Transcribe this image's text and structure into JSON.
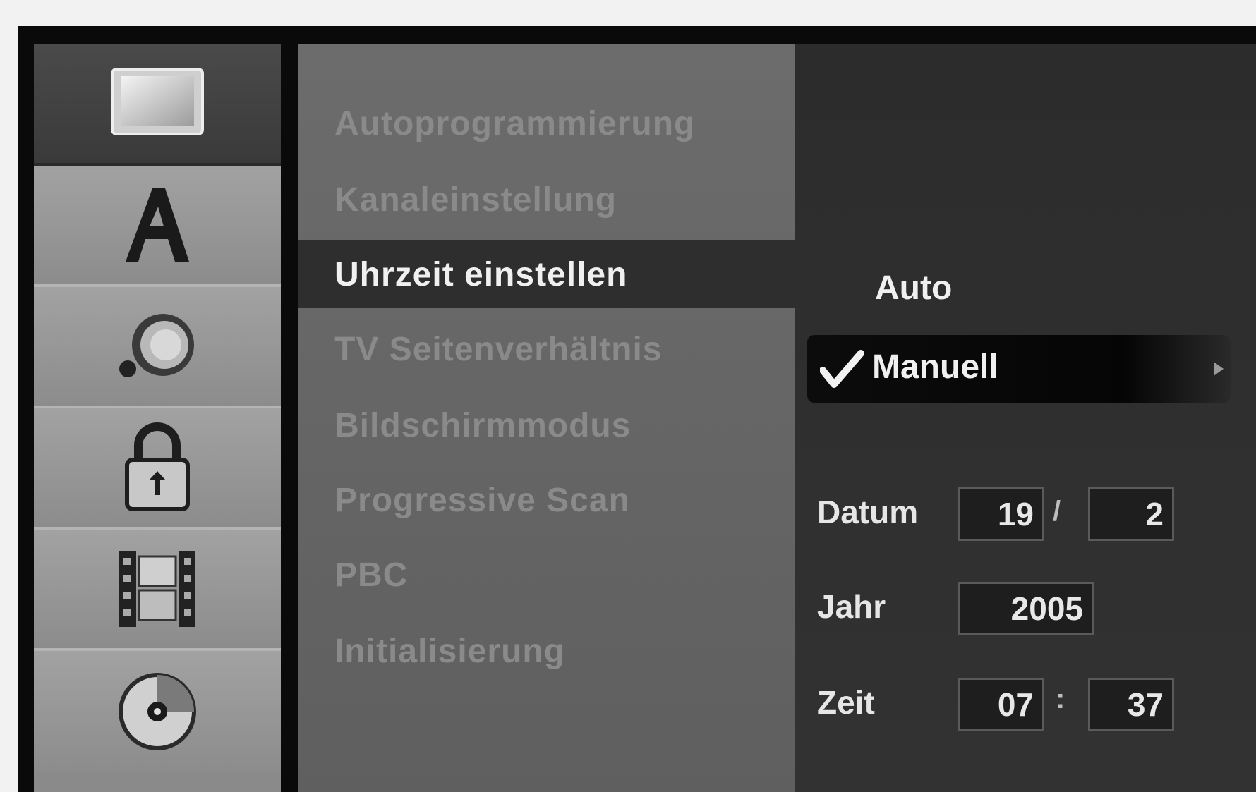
{
  "left_tabs": [
    {
      "icon": "monitor-icon",
      "active": true
    },
    {
      "icon": "language-a-icon",
      "active": false
    },
    {
      "icon": "speaker-icon",
      "active": false
    },
    {
      "icon": "lock-icon",
      "active": false
    },
    {
      "icon": "film-icon",
      "active": false
    },
    {
      "icon": "disc-icon",
      "active": false
    }
  ],
  "menu": {
    "items": [
      {
        "label": "Autoprogrammierung"
      },
      {
        "label": "Kanaleinstellung"
      },
      {
        "label": "Uhrzeit einstellen"
      },
      {
        "label": "TV Seitenverhältnis"
      },
      {
        "label": "Bildschirmmodus"
      },
      {
        "label": "Progressive Scan"
      },
      {
        "label": "PBC"
      },
      {
        "label": "Initialisierung"
      }
    ],
    "selected_index": 2
  },
  "subpanel": {
    "options": {
      "auto": "Auto",
      "manual": "Manuell"
    },
    "selected_option": "Manuell",
    "date": {
      "label": "Datum",
      "day": "19",
      "separator": "/",
      "month": "2"
    },
    "year": {
      "label": "Jahr",
      "value": "2005"
    },
    "time": {
      "label": "Zeit",
      "hour": "07",
      "separator": ":",
      "minute": "37"
    }
  },
  "colors": {
    "selected_bg": "#2e2e2e",
    "menu_bg": "#666666",
    "panel_bg": "#2f2f2f",
    "dim_text": "#8a8a8a",
    "bright_text": "#f0f0f0"
  }
}
